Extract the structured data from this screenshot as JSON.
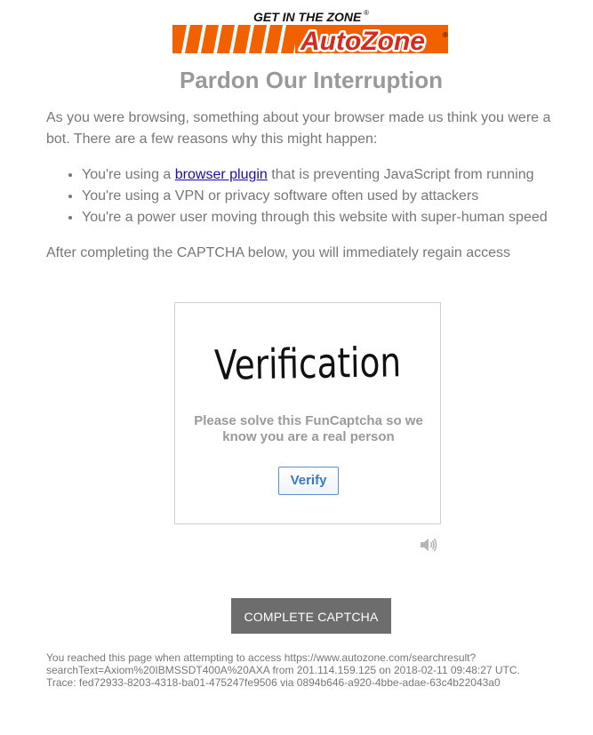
{
  "logo": {
    "tagline": "GET IN THE ZONE",
    "brand": "AutoZone",
    "trademark": "®",
    "brand_color": "#f26100",
    "brand_text_color": "#d52b1e"
  },
  "page": {
    "title": "Pardon Our Interruption",
    "intro": "As you were browsing, something about your browser made us think you were a bot. There are a few reasons why this might happen:",
    "reasons": [
      {
        "prefix": "You're using a ",
        "link": "browser plugin",
        "suffix": " that is preventing JavaScript from running"
      },
      {
        "text": "You're using a VPN or privacy software often used by attackers"
      },
      {
        "text": "You're a power user moving through this website with super-human speed"
      }
    ],
    "after": "After completing the CAPTCHA below, you will immediately regain access"
  },
  "captcha": {
    "heading": "Verification",
    "message": "Please solve this FunCaptcha so we know you are a real person",
    "verify_label": "Verify",
    "audio_icon": "speaker-icon",
    "accent_color": "#3778c8"
  },
  "complete_button": {
    "label": "COMPLETE CAPTCHA"
  },
  "footer": {
    "line1": "You reached this page when attempting to access https://www.autozone.com/searchresult?",
    "line2": "searchText=Axiom%20IBMSSDT400A%20AXA from 201.114.159.125 on 2018-02-11 09:48:27 UTC.",
    "line3": "Trace: fed72933-8203-4318-ba01-475247fe9506 via 0894b646-a920-4bbe-adae-63c4b22043a0"
  }
}
